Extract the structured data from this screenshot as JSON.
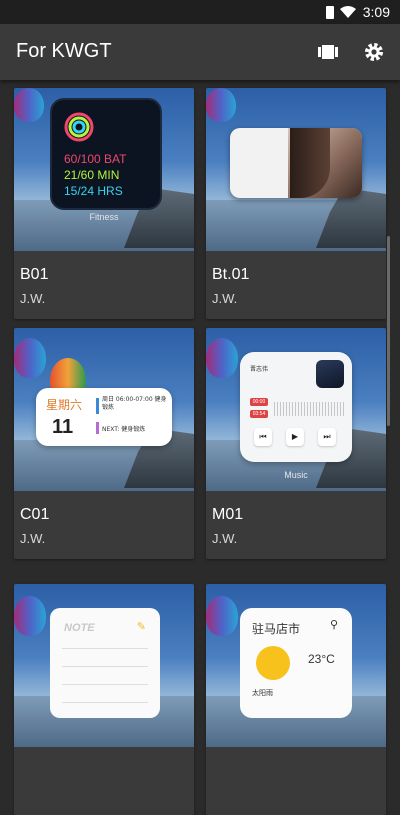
{
  "status_bar": {
    "time": "3:09"
  },
  "app_bar": {
    "title": "For KWGT"
  },
  "cards": [
    {
      "title": "B01",
      "author": "J.W."
    },
    {
      "title": "Bt.01",
      "author": "J.W."
    },
    {
      "title": "C01",
      "author": "J.W."
    },
    {
      "title": "M01",
      "author": "J.W."
    }
  ],
  "widgets": {
    "fitness": {
      "line1": "60/100 BAT",
      "line2": "21/60 MIN",
      "line3": "15/24 HRS",
      "label": "Fitness",
      "colors": [
        "#f0476b",
        "#b6f53b",
        "#39d2f0"
      ]
    },
    "calendar": {
      "day": "星期六",
      "date": "11",
      "event1": "周日 06:00-07:00 健身锻炼",
      "event2": "NEXT: 健身锻炼"
    },
    "music": {
      "song": "晋志伟",
      "tag1": "00:00",
      "tag2": "03:54",
      "prev": "⏮",
      "play": "▶",
      "next": "⏭",
      "label": "Music"
    },
    "note": {
      "header": "NOTE"
    },
    "weather": {
      "city": "驻马店市",
      "temp": "23°C",
      "sub": "太阳雨"
    }
  }
}
